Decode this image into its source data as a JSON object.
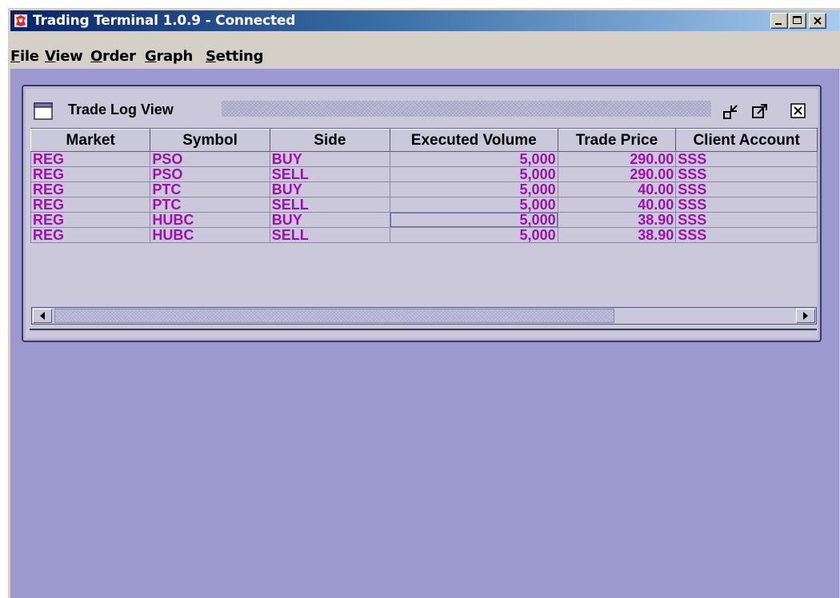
{
  "window": {
    "title": "Trading Terminal 1.0.9 - Connected",
    "icon": "app-logo-icon",
    "controls": [
      "minimize-icon",
      "maximize-icon",
      "close-icon"
    ]
  },
  "menubar": {
    "items": [
      {
        "label": "File"
      },
      {
        "label": "View"
      },
      {
        "label": "Order"
      },
      {
        "label": "Graph"
      },
      {
        "label": "Setting"
      }
    ]
  },
  "colors": {
    "desktop": "#9b99d0",
    "frame_background": "#cac8da",
    "cell_text": "#a010b0",
    "title_gradient_start": "#0a246a",
    "title_gradient_end": "#a6caf0"
  },
  "trade_log": {
    "title": "Trade Log View",
    "columns": [
      "Market",
      "Symbol",
      "Side",
      "Executed Volume",
      "Trade Price",
      "Client Account"
    ],
    "rows": [
      [
        "REG",
        "PSO",
        "BUY",
        "5,000",
        "290.00",
        "SSS"
      ],
      [
        "REG",
        "PSO",
        "SELL",
        "5,000",
        "290.00",
        "SSS"
      ],
      [
        "REG",
        "PTC",
        "BUY",
        "5,000",
        "40.00",
        "SSS"
      ],
      [
        "REG",
        "PTC",
        "SELL",
        "5,000",
        "40.00",
        "SSS"
      ],
      [
        "REG",
        "HUBC",
        "BUY",
        "5,000",
        "38.90",
        "SSS"
      ],
      [
        "REG",
        "HUBC",
        "SELL",
        "5,000",
        "38.90",
        "SSS"
      ]
    ],
    "selected_row": 4,
    "selected_column": 3
  }
}
